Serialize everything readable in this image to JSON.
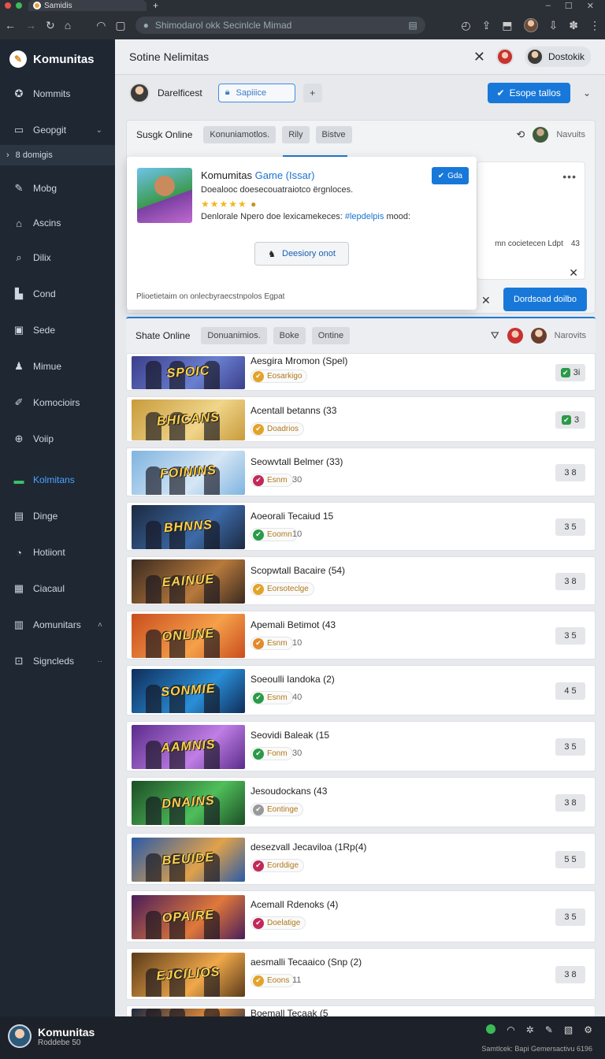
{
  "browser": {
    "tab_title": "Samidis",
    "url": "Shimodarol okk Secinlcle Mimad",
    "window_controls": [
      "–",
      "☐",
      "✕"
    ]
  },
  "sidebar": {
    "brand": "Komunitas",
    "items": [
      {
        "label": "Nommits",
        "icon": "compass-icon"
      },
      {
        "label": "Geopgit",
        "icon": "folder-icon",
        "caret": "⌄"
      },
      {
        "label": "Mobg",
        "icon": "edit-icon"
      },
      {
        "label": "Ascins",
        "icon": "home-icon"
      },
      {
        "label": "Dilix",
        "icon": "search-icon"
      },
      {
        "label": "Cond",
        "icon": "store-icon"
      },
      {
        "label": "Sede",
        "icon": "doc-icon"
      },
      {
        "label": "Mimue",
        "icon": "user-icon"
      },
      {
        "label": "Komocioirs",
        "icon": "tool-icon"
      },
      {
        "label": "Voiip",
        "icon": "plus-icon"
      },
      {
        "label": "Kolmitans",
        "icon": "chat-icon",
        "active": true
      },
      {
        "label": "Dinge",
        "icon": "page-icon"
      },
      {
        "label": "Hotiiont",
        "icon": "clock-icon"
      },
      {
        "label": "Ciacaul",
        "icon": "grid-icon"
      },
      {
        "label": "Aomunitars",
        "icon": "list-icon",
        "caret": "˄"
      },
      {
        "label": "Signcleds",
        "icon": "info-icon",
        "caret": "··"
      }
    ],
    "sub_item": "8 domigis"
  },
  "header": {
    "title": "Sotine Nelimitas",
    "user_name": "Dostokik"
  },
  "subbar": {
    "user_label": "Darelficest",
    "search_label": "Sapiiice",
    "action_label": "Esope tallos"
  },
  "panel1": {
    "title": "Susgk Online",
    "chips": [
      "Konuniamotlos.",
      "Rily",
      "Bistve"
    ],
    "side_user": "Navuits",
    "inner_card_text": "mn cocietecen Ldpt",
    "inner_card_num": "43",
    "popup": {
      "title_main": "Komumitas",
      "title_link": "Game (Issar)",
      "subtitle": "Doealooc doesecouatraiotco ërgnloces.",
      "stars": "★★★★★",
      "line_main": "Denlorale Npero doe lexicamekeces:",
      "line_link": "#lepdelpis",
      "line_end": "mood:",
      "badge": "Gda",
      "button": "Deesiory onot",
      "footer": "Plioetietaim on onlecbyraecstnpolos Egpat"
    },
    "download_button": "Dordsoad doilbo"
  },
  "list_header": {
    "title": "Shate Online",
    "chips": [
      "Donuanimios.",
      "Boke",
      "Ontine"
    ],
    "side_user": "Narovits"
  },
  "games": [
    {
      "name": "Aesgira Mromon (Spel)",
      "tag": "Eosarkigo",
      "count": "",
      "score": "3i",
      "check": true,
      "colors": [
        "#3b3f8c",
        "#6a7fd0"
      ],
      "logo": "SPOIC",
      "tag_color": "#e3a32b"
    },
    {
      "name": "Acentall betanns (33",
      "tag": "Doadrios",
      "count": "",
      "score": "3",
      "check": true,
      "colors": [
        "#c89b3c",
        "#f0d58a"
      ],
      "logo": "BHICANS",
      "tag_color": "#e3a32b"
    },
    {
      "name": "Seowvtall Belmer (33)",
      "tag": "Esnm",
      "count": "30",
      "score": "3 8",
      "check": false,
      "colors": [
        "#7fb4e0",
        "#d6e6f5"
      ],
      "logo": "FOININS",
      "tag_color": "#c2295b"
    },
    {
      "name": "Aoeorali Tecaiud 15",
      "tag": "Eoomn",
      "count": "10",
      "score": "3 5",
      "check": false,
      "colors": [
        "#1c2a40",
        "#3d6aa8"
      ],
      "logo": "BHNNS",
      "tag_color": "#2b9a48"
    },
    {
      "name": "Scopwtall Bacaire (54)",
      "tag": "Eorsoteclge",
      "count": "",
      "score": "3 8",
      "check": false,
      "colors": [
        "#3a2a20",
        "#b87a3c"
      ],
      "logo": "EAINUE",
      "tag_color": "#e3a32b"
    },
    {
      "name": "Apemali Betimot (43",
      "tag": "Esnm",
      "count": "10",
      "score": "3 5",
      "check": false,
      "colors": [
        "#c94d1e",
        "#f5a04a"
      ],
      "logo": "ONLINE",
      "tag_color": "#e38a2b"
    },
    {
      "name": "Soeoulli Iandoka (2)",
      "tag": "Esnm",
      "count": "40",
      "score": "4 5",
      "check": false,
      "colors": [
        "#0f2d5a",
        "#2a8fd8"
      ],
      "logo": "SONMIE",
      "tag_color": "#2b9a48"
    },
    {
      "name": "Seovidi Baleak (15",
      "tag": "Fonm",
      "count": "30",
      "score": "3 5",
      "check": false,
      "colors": [
        "#5a2c8a",
        "#c07ee6"
      ],
      "logo": "AAMNIS",
      "tag_color": "#2b9a48"
    },
    {
      "name": "Jesoudockans (43",
      "tag": "Eontinge",
      "count": "",
      "score": "3 8",
      "check": false,
      "colors": [
        "#1d4d26",
        "#4fbf5a"
      ],
      "logo": "DNAINS",
      "tag_color": "#999999"
    },
    {
      "name": "desezvall Jecaviloa (1Rp(4)",
      "tag": "Eorddige",
      "count": "",
      "score": "5 5",
      "check": false,
      "colors": [
        "#2a5aa8",
        "#e0a24a"
      ],
      "logo": "BEUIDE",
      "tag_color": "#c2295b"
    },
    {
      "name": "Acemall Rdenoks (4)",
      "tag": "Doelatige",
      "count": "",
      "score": "3 5",
      "check": false,
      "colors": [
        "#4a1d5a",
        "#e0783a"
      ],
      "logo": "OPAIRE",
      "tag_color": "#c2295b"
    },
    {
      "name": "aesmalli Tecaaico (Snp (2)",
      "tag": "Eoons",
      "count": "11",
      "score": "3 8",
      "check": false,
      "colors": [
        "#5a3a1a",
        "#f0a84a"
      ],
      "logo": "EJCILIOS",
      "tag_color": "#e3a32b"
    },
    {
      "name": "Boemall Tecaak (5",
      "tag": "",
      "count": "",
      "score": "",
      "check": false,
      "colors": [
        "#1c2a40",
        "#e08a3a"
      ],
      "logo": "",
      "tag_color": "#e3a32b"
    }
  ],
  "taskbar": {
    "title": "Komunitas",
    "subtitle": "Roddebe 50",
    "status": "Samtlcek: Bapi Gemersactivu 6196"
  }
}
